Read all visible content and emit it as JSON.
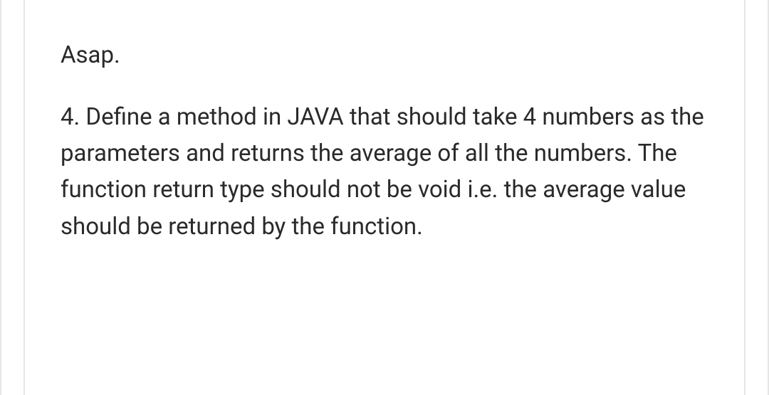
{
  "document": {
    "intro": "Asap.",
    "question": "4. Define a method in JAVA that should take 4 numbers as the parameters and returns the average of all the numbers. The function return type should not be void i.e. the average value should be returned by the function."
  }
}
